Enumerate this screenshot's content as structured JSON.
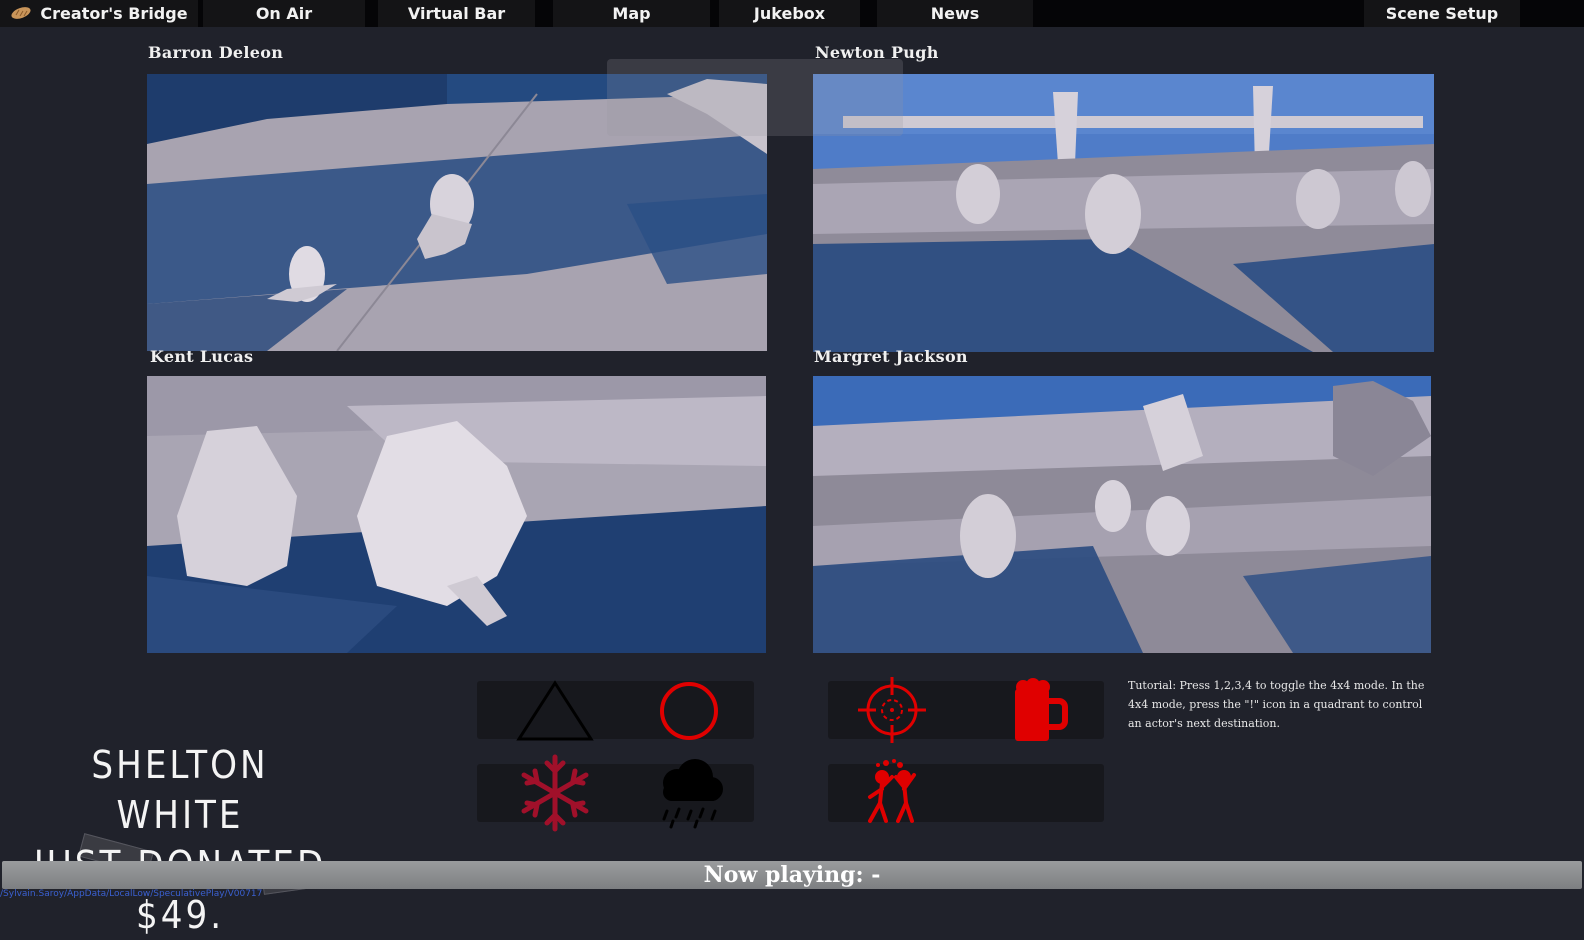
{
  "nav": {
    "brand": "Creator's Bridge",
    "tabs": [
      "On Air",
      "Virtual Bar",
      "Map",
      "Jukebox",
      "News"
    ],
    "scene_setup": "Scene Setup"
  },
  "cameras": [
    {
      "name": "Barron Deleon"
    },
    {
      "name": "Newton Pugh"
    },
    {
      "name": "Kent Lucas"
    },
    {
      "name": "Margret Jackson"
    }
  ],
  "controls": {
    "left_row1": [
      "triangle-icon",
      "circle-icon"
    ],
    "left_row2": [
      "snowflake-icon",
      "rain-cloud-icon"
    ],
    "right_row1": [
      "crosshair-icon",
      "beer-mug-icon"
    ],
    "right_row2": [
      "fighting-people-icon"
    ],
    "accent_red": "#e00000",
    "snow_color": "#a0102a"
  },
  "tutorial": "Tutorial: Press 1,2,3,4 to toggle the 4x4 mode. In the 4x4 mode, press the \"!\" icon in a quadrant to control an actor's next destination.",
  "donation": {
    "line1": "SHELTON WHITE",
    "line2": "JUST DONATED",
    "line3": "$49."
  },
  "now_playing": "Now playing: -",
  "path_text": "/Sylvain.Saroy/AppData/LocalLow/SpeculativePlay/V00717"
}
